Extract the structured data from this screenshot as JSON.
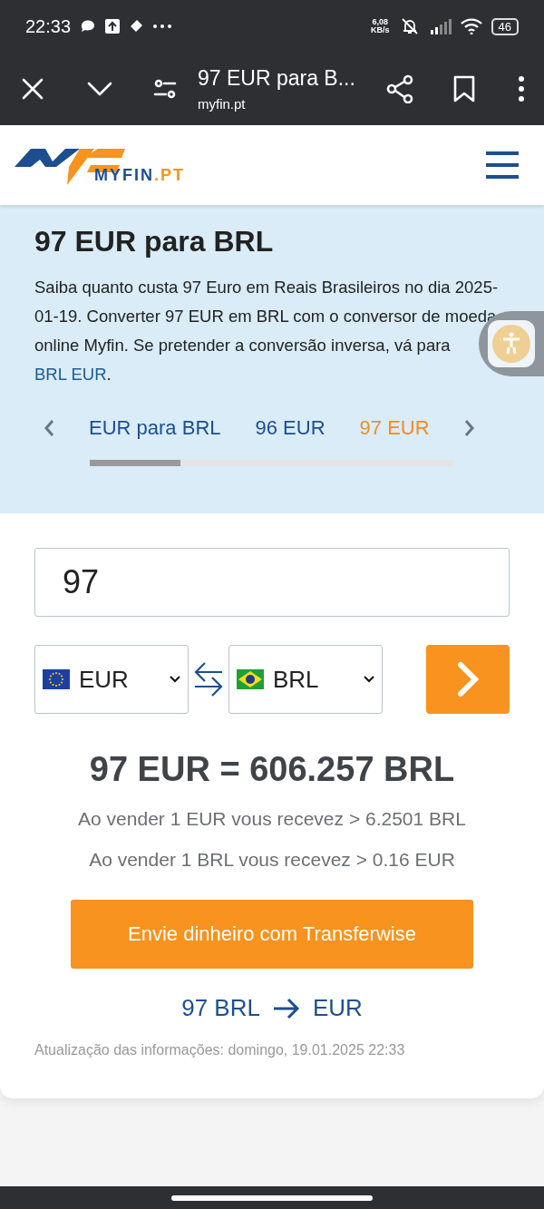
{
  "status_bar": {
    "time": "22:33",
    "net_speed": "6,08",
    "net_unit": "KB/s",
    "battery": "46"
  },
  "browser": {
    "title": "97 EUR para B...",
    "url": "myfin.pt"
  },
  "site_header": {
    "logo_name": "MYFIN",
    "logo_tld": ".PT"
  },
  "hero": {
    "title": "97 EUR para BRL",
    "description": "Saiba quanto custa 97 Euro em Reais Brasileiros no dia 2025-01-19. Converter 97 EUR em BRL com o conversor de moeda online Myfin. Se pretender a conversão inversa, vá para ",
    "link": "BRL EUR",
    "description_end": ".",
    "tabs": [
      {
        "label": "EUR para BRL",
        "selected": false
      },
      {
        "label": "96 EUR",
        "selected": false
      },
      {
        "label": "97 EUR",
        "selected": true
      }
    ]
  },
  "converter": {
    "amount": "97",
    "from": {
      "code": "EUR"
    },
    "to": {
      "code": "BRL"
    },
    "result": "97 EUR = 606.257 BRL",
    "rates": [
      "Ao vender 1 EUR vous recevez > 6.2501 BRL",
      "Ao vender 1 BRL vous recevez > 0.16 EUR"
    ],
    "transfer_button": "Envie dinheiro com Transferwise",
    "reverse_from": "97 BRL",
    "reverse_to": "EUR",
    "updated": "Atualização das informações: domingo, 19.01.2025 22:33"
  }
}
